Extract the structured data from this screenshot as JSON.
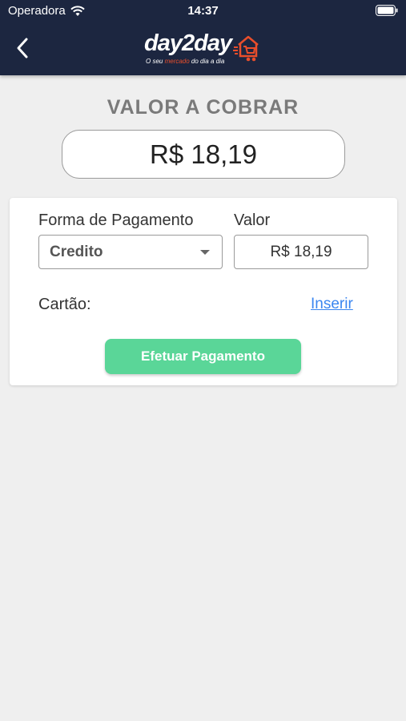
{
  "status_bar": {
    "carrier": "Operadora",
    "time": "14:37",
    "wifi_icon": "wifi-icon",
    "battery_icon": "battery-icon"
  },
  "header": {
    "back_icon": "chevron-left-icon",
    "logo": {
      "word_start": "day",
      "word_two": "2",
      "word_end": "day",
      "tagline_before": "O seu ",
      "tagline_accent": "mercado",
      "tagline_after": " do dia a dia",
      "cart_icon": "shopping-cart-icon"
    },
    "colors": {
      "background": "#1c2640",
      "accent": "#e94e2b"
    }
  },
  "main": {
    "title": "VALOR A COBRAR",
    "amount": "R$ 18,19"
  },
  "payment_card": {
    "payment_method_label": "Forma de Pagamento",
    "payment_method_selected": "Credito",
    "value_label": "Valor",
    "value": "R$ 18,19",
    "card_label": "Cartão:",
    "insert_link": "Inserir",
    "pay_button": "Efetuar Pagamento",
    "colors": {
      "button": "#5ad698",
      "link": "#3a86f0"
    }
  }
}
